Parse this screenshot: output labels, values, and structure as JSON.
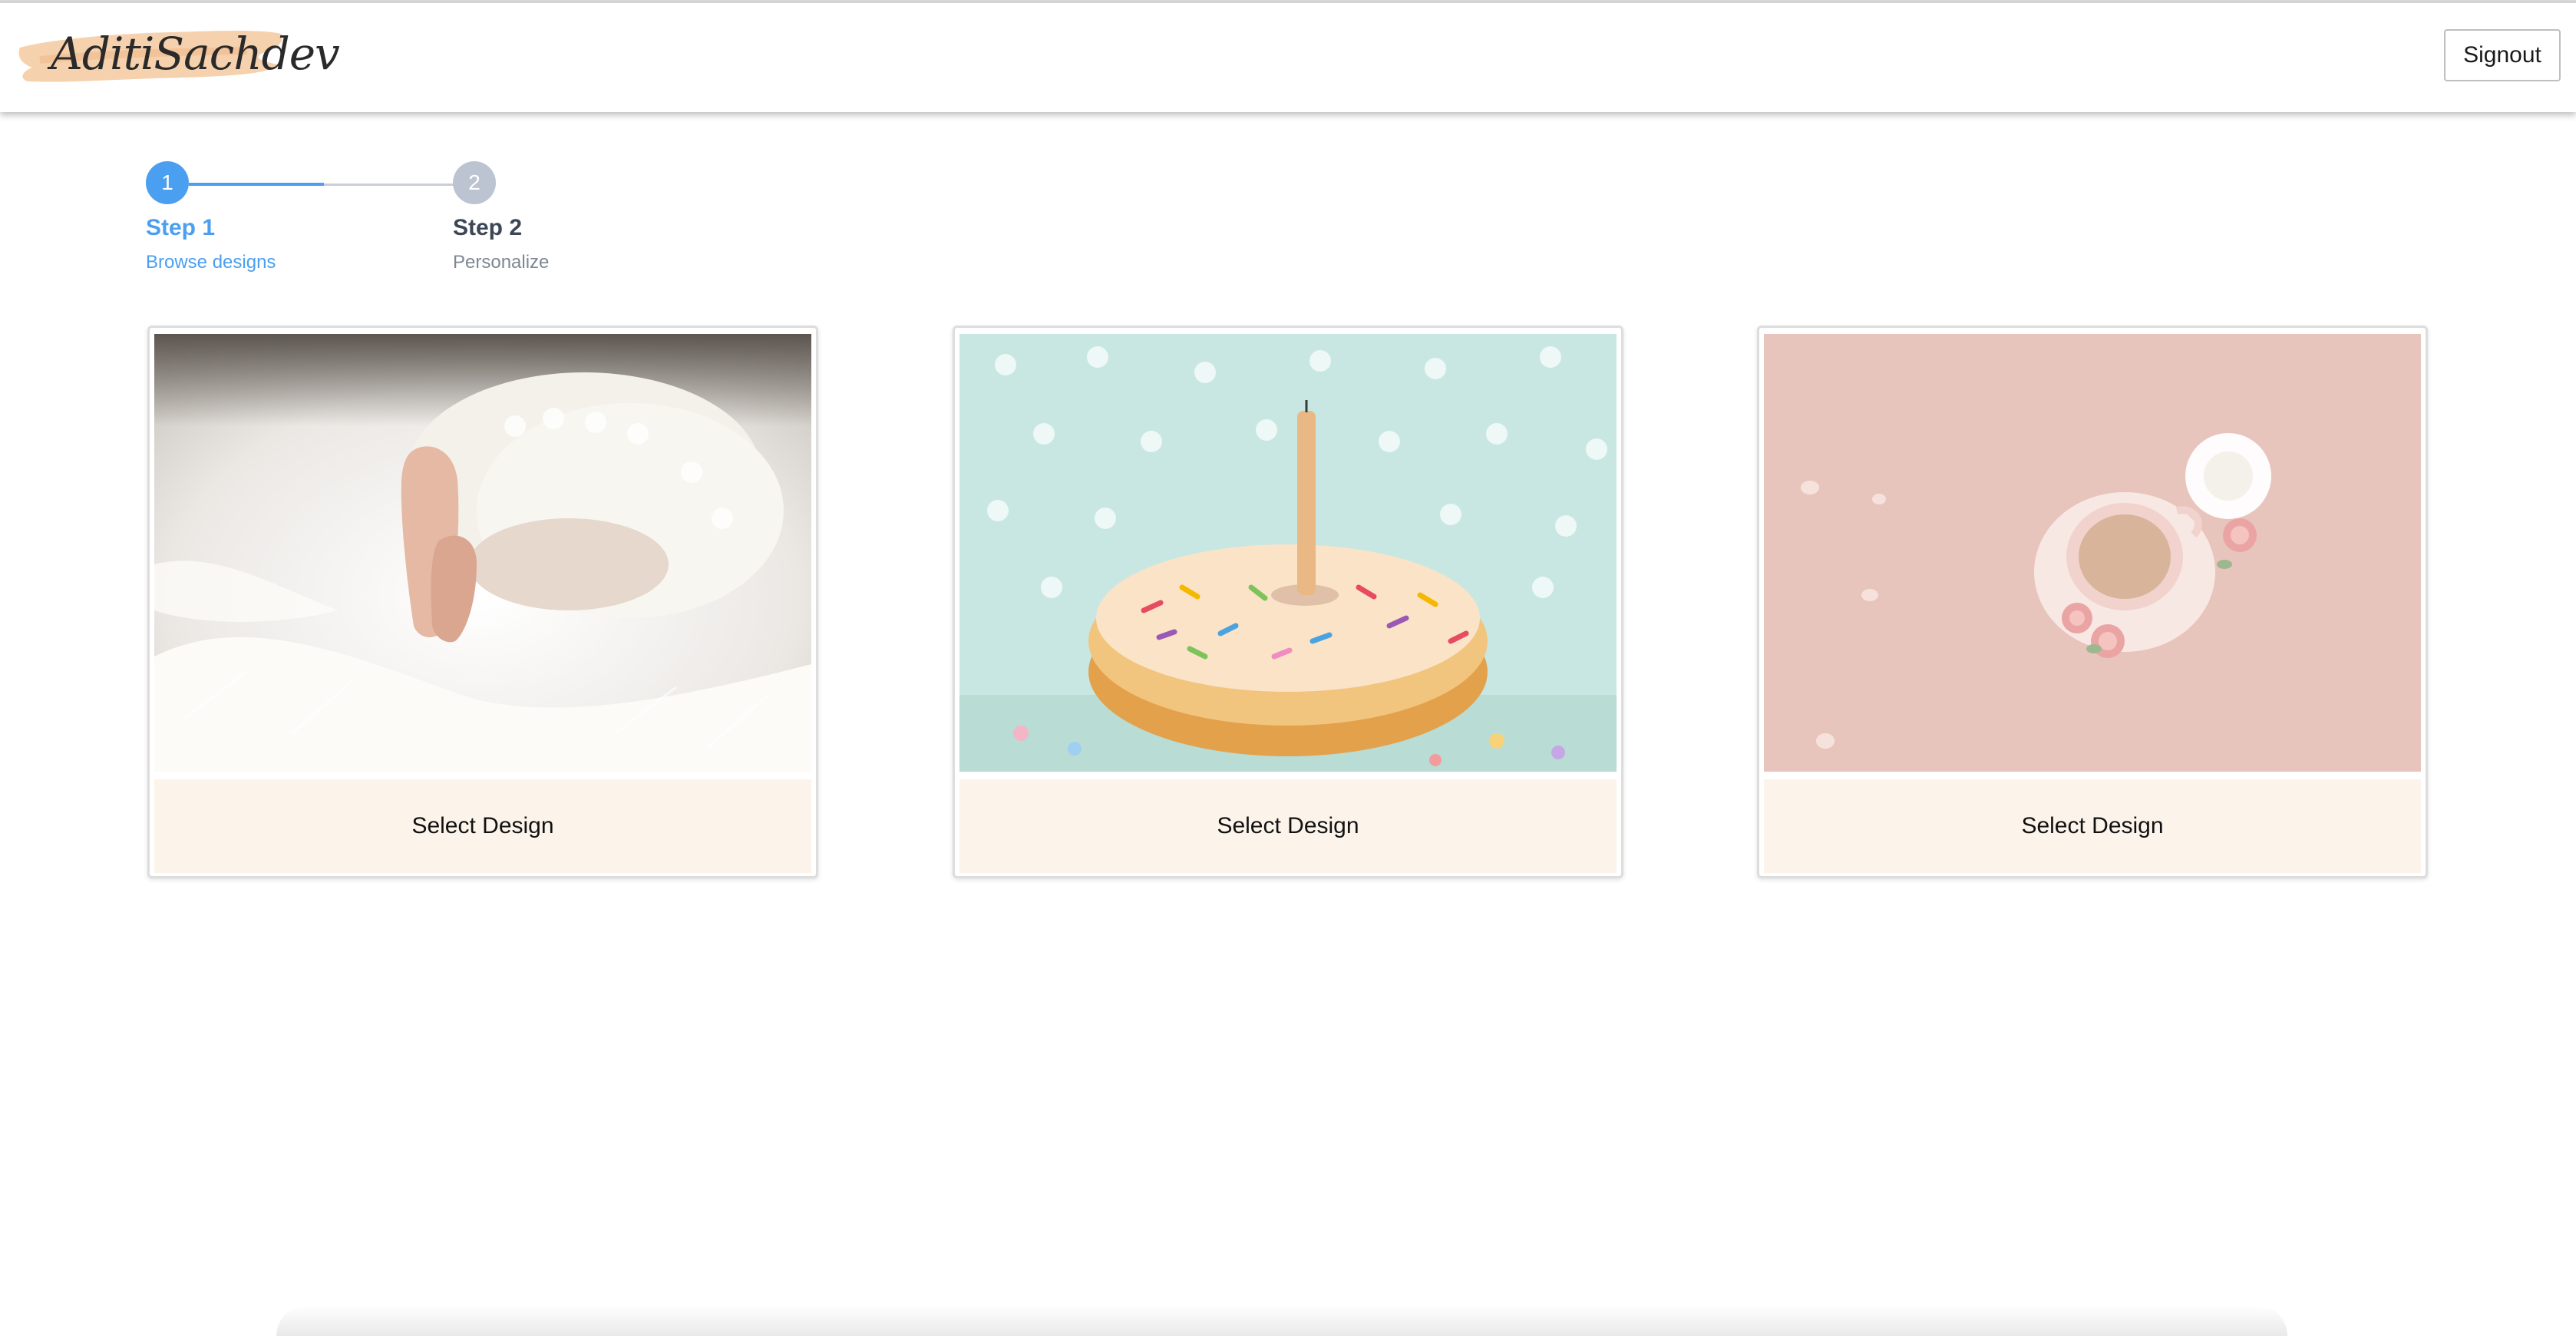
{
  "header": {
    "logo_text": "AditiSachdev",
    "signout_label": "Signout"
  },
  "stepper": {
    "steps": [
      {
        "number": "1",
        "title": "Step 1",
        "subtitle": "Browse designs",
        "state": "active"
      },
      {
        "number": "2",
        "title": "Step 2",
        "subtitle": "Personalize",
        "state": "inactive"
      }
    ]
  },
  "designs": [
    {
      "image_icon": "baby-feet-on-fur-photo",
      "button_label": "Select Design"
    },
    {
      "image_icon": "donut-with-candle-photo",
      "button_label": "Select Design"
    },
    {
      "image_icon": "coffee-cup-with-roses-photo",
      "button_label": "Select Design"
    }
  ],
  "colors": {
    "accent": "#4a9ff0",
    "inactive_step": "#bcc4d1",
    "card_button_bg": "#fcf4eb"
  }
}
